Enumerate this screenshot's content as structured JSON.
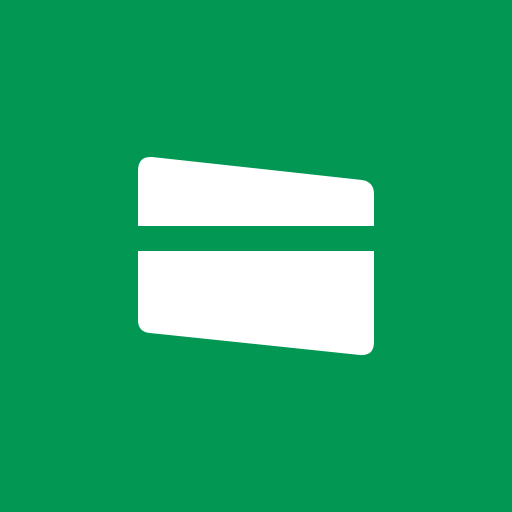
{
  "icon": {
    "name": "card-icon",
    "background_color": "#029753",
    "glyph_color": "#FFFFFF"
  }
}
